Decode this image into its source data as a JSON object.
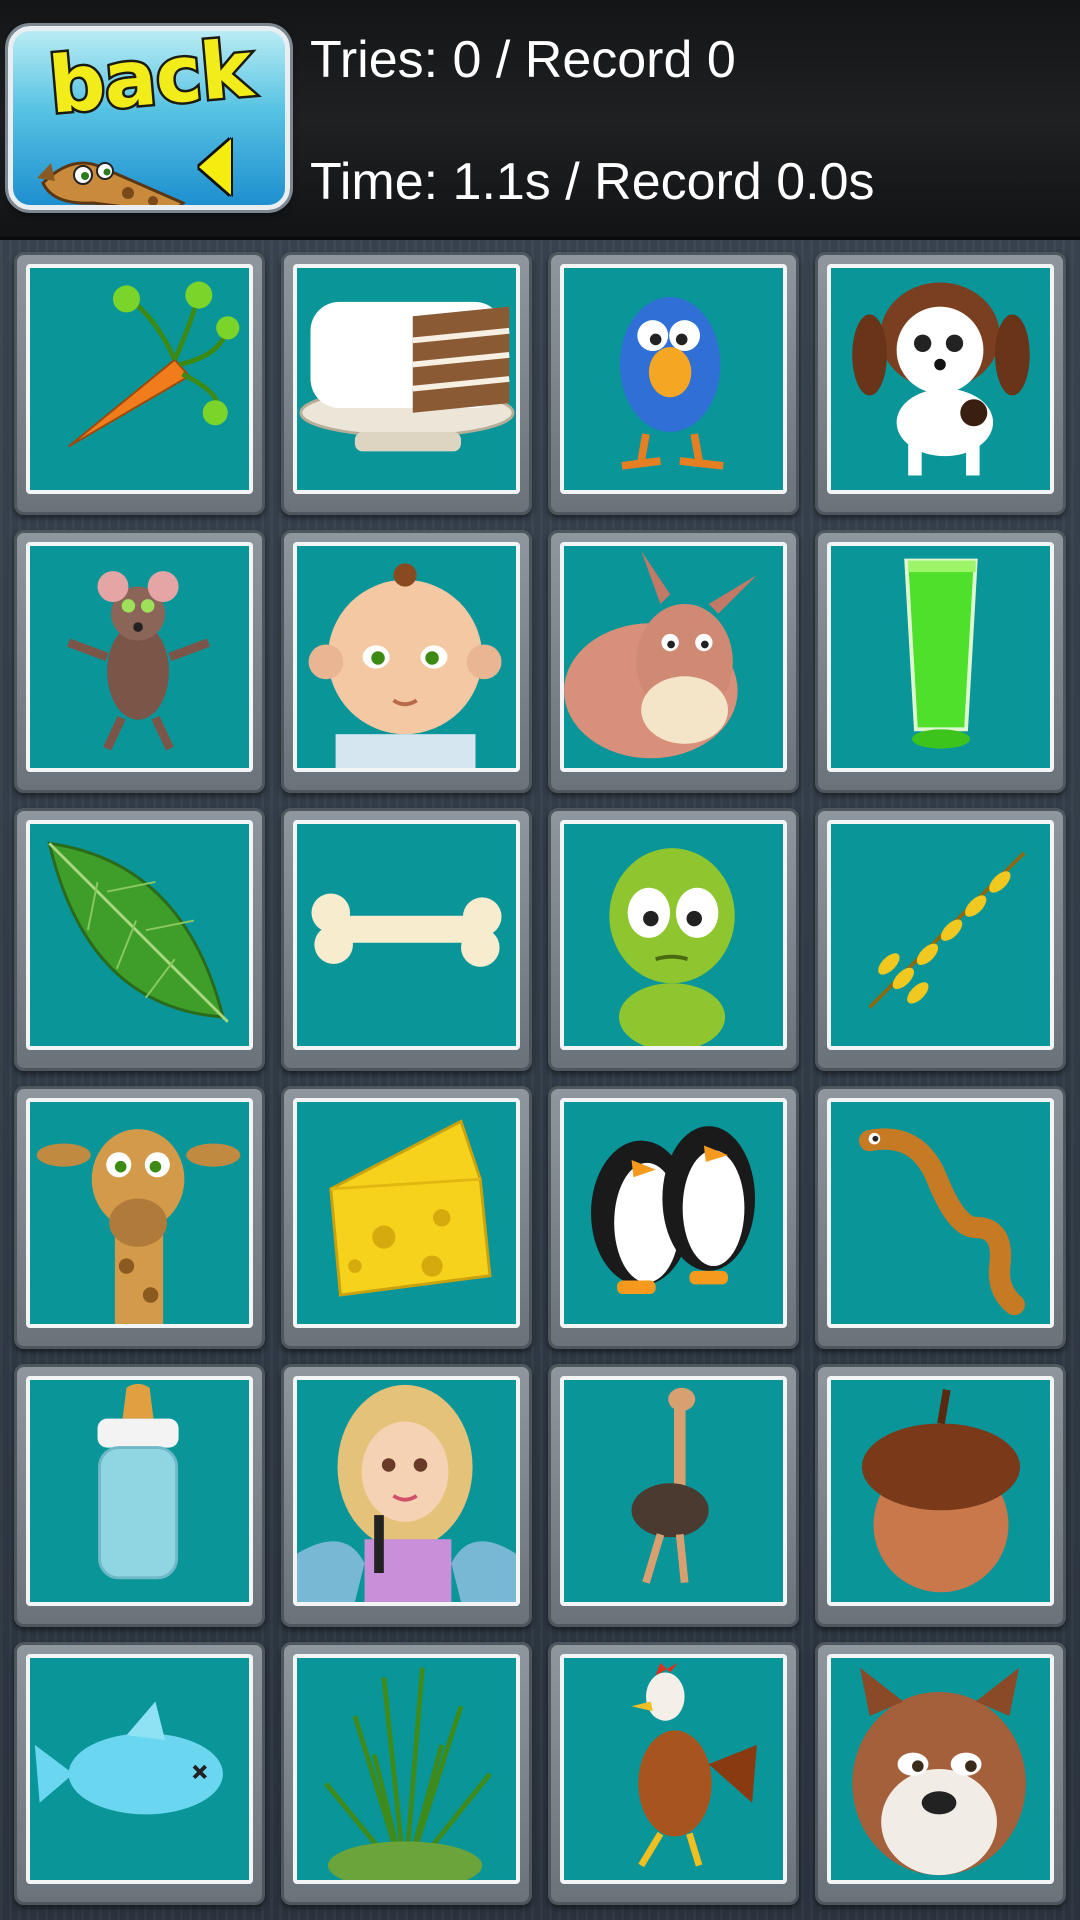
{
  "header": {
    "back_label": "back",
    "tries_text": "Tries: 0 / Record 0",
    "time_text": "Time: 1.1s / Record 0.0s"
  },
  "board": {
    "columns": 4,
    "rows": 6,
    "cards": [
      {
        "name": "carrot-card",
        "icon": "carrot-icon"
      },
      {
        "name": "cake-card",
        "icon": "cake-icon"
      },
      {
        "name": "bird-card",
        "icon": "bird-icon"
      },
      {
        "name": "puppy-card",
        "icon": "puppy-icon"
      },
      {
        "name": "mouse-card",
        "icon": "mouse-icon"
      },
      {
        "name": "baby-card",
        "icon": "baby-icon"
      },
      {
        "name": "donkey-card",
        "icon": "donkey-icon"
      },
      {
        "name": "green-drink-card",
        "icon": "green-drink-icon"
      },
      {
        "name": "leaf-card",
        "icon": "leaf-icon"
      },
      {
        "name": "bone-card",
        "icon": "bone-icon"
      },
      {
        "name": "frog-card",
        "icon": "frog-icon"
      },
      {
        "name": "wheat-card",
        "icon": "wheat-icon"
      },
      {
        "name": "giraffe-card",
        "icon": "giraffe-icon"
      },
      {
        "name": "cheese-card",
        "icon": "cheese-icon"
      },
      {
        "name": "penguins-card",
        "icon": "penguins-icon"
      },
      {
        "name": "worm-card",
        "icon": "worm-icon"
      },
      {
        "name": "baby-bottle-card",
        "icon": "baby-bottle-icon"
      },
      {
        "name": "fairy-singer-card",
        "icon": "fairy-singer-icon"
      },
      {
        "name": "ostrich-card",
        "icon": "ostrich-icon"
      },
      {
        "name": "acorn-card",
        "icon": "acorn-icon"
      },
      {
        "name": "fish-card",
        "icon": "fish-icon"
      },
      {
        "name": "grass-card",
        "icon": "grass-icon"
      },
      {
        "name": "chicken-card",
        "icon": "chicken-icon"
      },
      {
        "name": "squirrel-card",
        "icon": "squirrel-icon"
      }
    ]
  },
  "colors": {
    "card_face": "#0a9598",
    "text": "#ffffff",
    "back_text": "#f2ec1a"
  }
}
